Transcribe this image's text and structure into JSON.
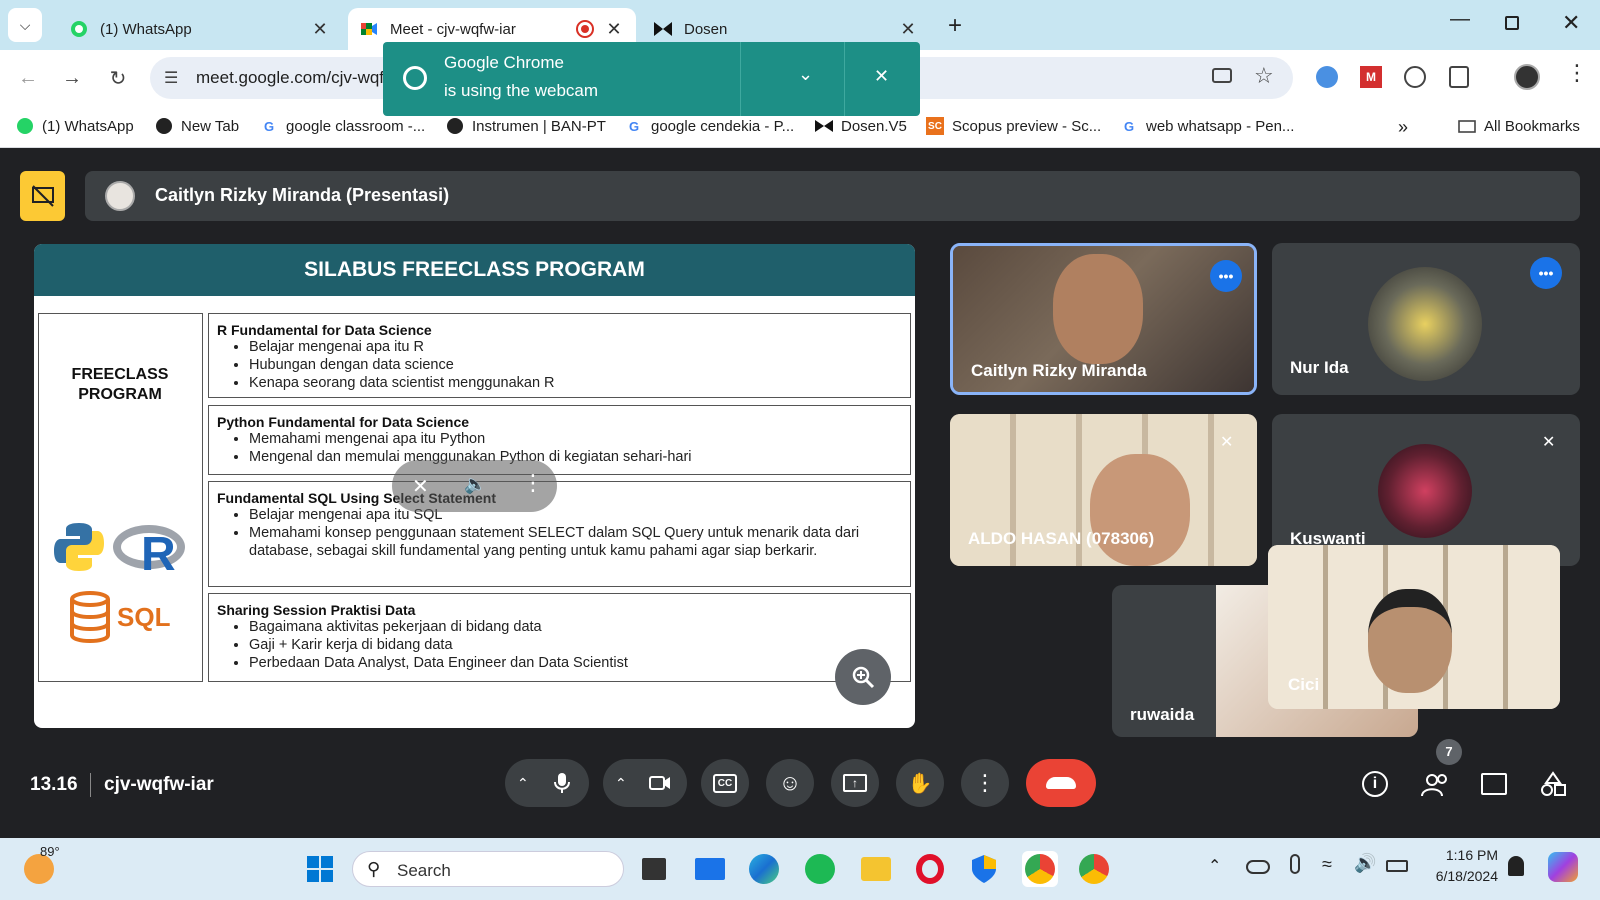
{
  "tabs": [
    {
      "label": "(1) WhatsApp",
      "icon": "whatsapp-icon"
    },
    {
      "label": "Meet - cjv-wqfw-iar",
      "icon": "meet-icon"
    },
    {
      "label": "Dosen",
      "icon": "dosen-icon"
    }
  ],
  "omnibox": {
    "url": "meet.google.com/cjv-wqfw-iar?pli=1"
  },
  "notification": {
    "line1": "Google Chrome",
    "line2": "is using the webcam"
  },
  "bookmarks": [
    {
      "label": "(1) WhatsApp"
    },
    {
      "label": "New Tab"
    },
    {
      "label": "google classroom -..."
    },
    {
      "label": "Instrumen | BAN-PT"
    },
    {
      "label": "google cendekia - P..."
    },
    {
      "label": "Dosen.V5"
    },
    {
      "label": "Scopus preview - Sc..."
    },
    {
      "label": "web whatsapp - Pen..."
    }
  ],
  "bookmarks_all": "All Bookmarks",
  "presenter": {
    "label": "Caitlyn Rizky Miranda (Presentasi)"
  },
  "slide": {
    "title": "SILABUS FREECLASS PROGRAM",
    "left_label_1": "FREECLASS",
    "left_label_2": "PROGRAM",
    "sql_label": "SQL",
    "r_label": "R",
    "sections": [
      {
        "title": "R Fundamental for Data Science",
        "items": [
          "Belajar mengenai apa itu R",
          "Hubungan dengan data science",
          "Kenapa seorang data scientist menggunakan R"
        ]
      },
      {
        "title": "Python Fundamental for Data Science",
        "items": [
          "Memahami mengenai apa itu Python",
          "Mengenal dan memulai menggunakan Python di kegiatan sehari-hari"
        ]
      },
      {
        "title": "Fundamental SQL Using Select Statement",
        "items": [
          "Belajar mengenai apa itu SQL",
          "Memahami konsep penggunaan statement SELECT dalam SQL Query untuk menarik data dari database, sebagai skill fundamental yang penting untuk kamu pahami agar siap berkarir."
        ]
      },
      {
        "title": "Sharing Session Praktisi Data",
        "items": [
          "Bagaimana aktivitas pekerjaan di bidang data",
          "Gaji + Karir kerja di bidang data",
          "Perbedaan Data Analyst, Data Engineer dan Data Scientist"
        ]
      }
    ]
  },
  "participants": [
    {
      "name": "Caitlyn Rizky Miranda"
    },
    {
      "name": "Nur Ida"
    },
    {
      "name": "ALDO HASAN (078306)"
    },
    {
      "name": "Kuswanti"
    },
    {
      "name": "ruwaida"
    },
    {
      "name": "Cici"
    }
  ],
  "meeting": {
    "time": "13.16",
    "code": "cjv-wqfw-iar",
    "participant_count": "7"
  },
  "taskbar": {
    "temp": "89°",
    "search": "Search",
    "time": "1:16 PM",
    "date": "6/18/2024"
  },
  "colors": {
    "accent_blue": "#8ab4f8",
    "end_call": "#ea4335",
    "slide_header": "#1f5f6b",
    "notif": "#1d8f86"
  }
}
